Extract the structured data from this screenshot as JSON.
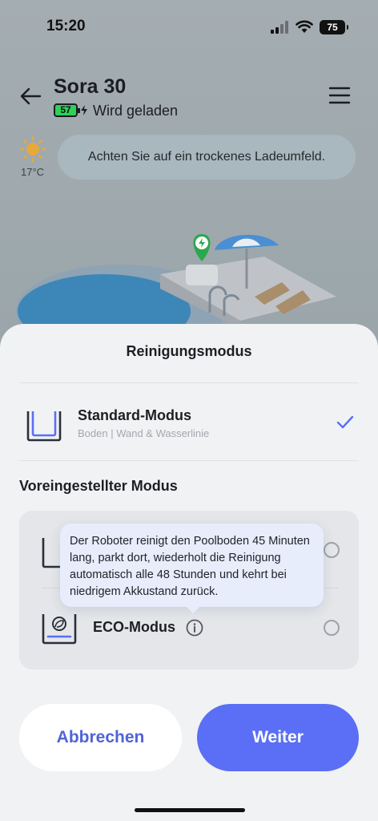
{
  "status_bar": {
    "time": "15:20",
    "battery": "75"
  },
  "header": {
    "device_name": "Sora 30",
    "battery_level": "57",
    "charging_status": "Wird geladen"
  },
  "weather": {
    "temperature": "17°C"
  },
  "tip": "Achten Sie auf ein trockenes Ladeumfeld.",
  "sheet": {
    "title": "Reinigungsmodus",
    "standard_mode": {
      "title": "Standard-Modus",
      "subtitle": "Boden | Wand & Wasserlinie",
      "selected": true
    },
    "preset_section_title": "Voreingestellter Modus",
    "preset_modes": [
      {
        "label": "",
        "selected": false
      },
      {
        "label": "ECO-Modus",
        "selected": false
      }
    ],
    "tooltip": "Der Roboter reinigt den Poolboden 45 Minuten lang, parkt dort, wiederholt die Reinigung automatisch alle 48 Stunden und kehrt bei niedrigem Akkustand zurück."
  },
  "buttons": {
    "cancel": "Abbrechen",
    "next": "Weiter"
  },
  "colors": {
    "accent": "#5a6ff5",
    "accent_text": "#5063d8",
    "battery_green": "#2fd05a"
  }
}
